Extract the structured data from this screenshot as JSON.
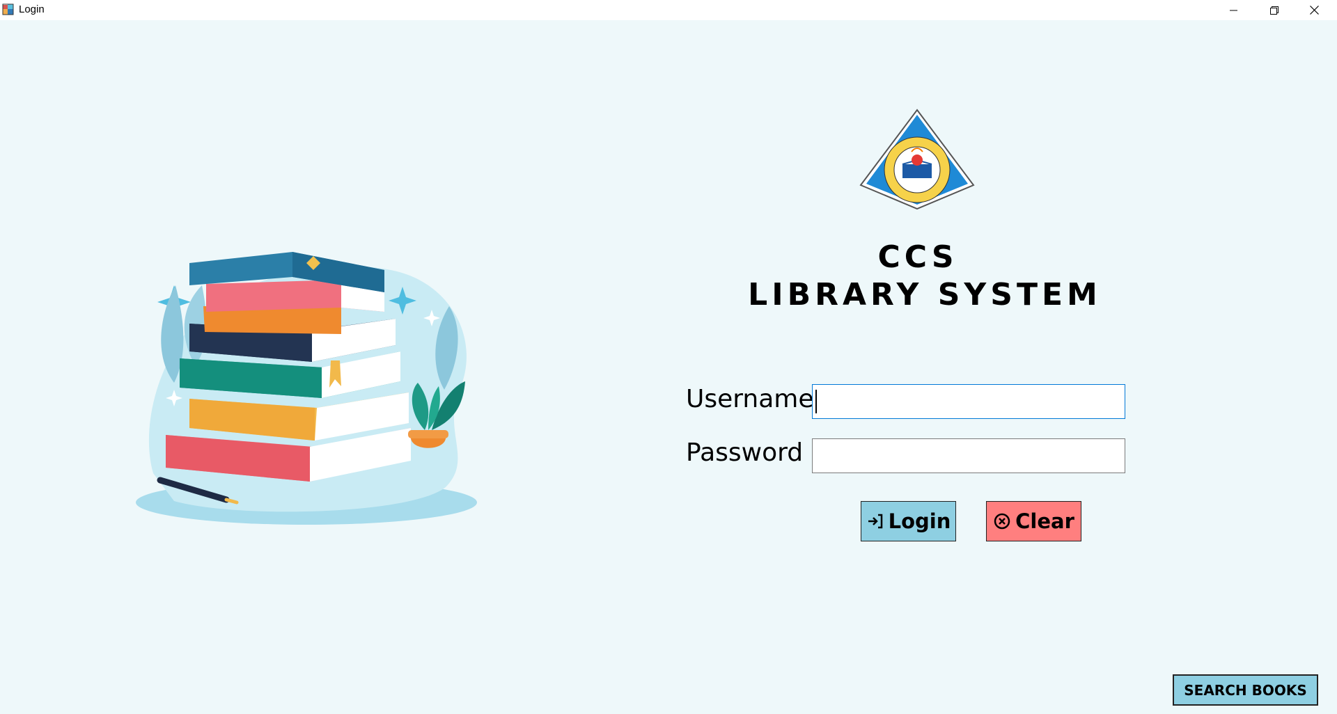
{
  "window": {
    "title": "Login",
    "controls": [
      "minimize",
      "restore",
      "close"
    ]
  },
  "header": {
    "line1": "CCS",
    "line2": "LIBRARY SYSTEM"
  },
  "form": {
    "username_label": "Username",
    "username_value": "",
    "password_label": "Password",
    "password_value": ""
  },
  "buttons": {
    "login_label": "Login",
    "clear_label": "Clear",
    "search_label": "SEARCH BOOKS"
  },
  "icons": {
    "login": "login-arrow-icon",
    "clear": "circle-x-icon"
  },
  "colors": {
    "background": "#eef8fa",
    "login_button": "#8ecfe2",
    "clear_button": "#ff7f7f",
    "search_button": "#8ecfe2"
  }
}
